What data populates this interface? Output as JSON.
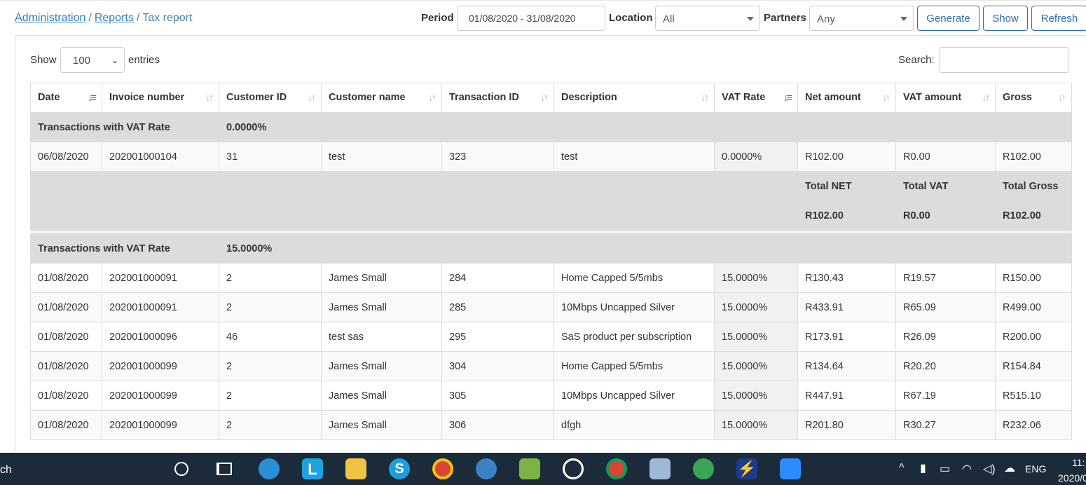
{
  "breadcrumb": {
    "items": [
      "Administration",
      "Reports",
      "Tax report"
    ]
  },
  "filters": {
    "period_label": "Period",
    "period_value": "01/08/2020 - 31/08/2020",
    "location_label": "Location",
    "location_value": "All",
    "partners_label": "Partners",
    "partners_value": "Any"
  },
  "buttons": {
    "generate": "Generate",
    "show": "Show",
    "refresh": "Refresh"
  },
  "table_controls": {
    "show_label": "Show",
    "entries_value": "100",
    "entries_label": "entries",
    "search_label": "Search:"
  },
  "columns": [
    "Date",
    "Invoice number",
    "Customer ID",
    "Customer name",
    "Transaction ID",
    "Description",
    "VAT Rate",
    "Net amount",
    "VAT amount",
    "Gross"
  ],
  "groups": [
    {
      "label": "Transactions with VAT Rate",
      "rate": "0.0000%",
      "rows": [
        [
          "06/08/2020",
          "202001000104",
          "31",
          "test",
          "323",
          "test",
          "0.0000%",
          "R102.00",
          "R0.00",
          "R102.00"
        ]
      ],
      "totals": {
        "net_label": "Total NET",
        "vat_label": "Total VAT",
        "gross_label": "Total Gross",
        "net": "R102.00",
        "vat": "R0.00",
        "gross": "R102.00"
      }
    },
    {
      "label": "Transactions with VAT Rate",
      "rate": "15.0000%",
      "rows": [
        [
          "01/08/2020",
          "202001000091",
          "2",
          "James Small",
          "284",
          "Home Capped 5/5mbs",
          "15.0000%",
          "R130.43",
          "R19.57",
          "R150.00"
        ],
        [
          "01/08/2020",
          "202001000091",
          "2",
          "James Small",
          "285",
          "10Mbps Uncapped Silver",
          "15.0000%",
          "R433.91",
          "R65.09",
          "R499.00"
        ],
        [
          "01/08/2020",
          "202001000096",
          "46",
          "test sas",
          "295",
          "SaS product per subscription",
          "15.0000%",
          "R173.91",
          "R26.09",
          "R200.00"
        ],
        [
          "01/08/2020",
          "202001000099",
          "2",
          "James Small",
          "304",
          "Home Capped 5/5mbs",
          "15.0000%",
          "R134.64",
          "R20.20",
          "R154.84"
        ],
        [
          "01/08/2020",
          "202001000099",
          "2",
          "James Small",
          "305",
          "10Mbps Uncapped Silver",
          "15.0000%",
          "R447.91",
          "R67.19",
          "R515.10"
        ],
        [
          "01/08/2020",
          "202001000099",
          "2",
          "James Small",
          "306",
          "dfgh",
          "15.0000%",
          "R201.80",
          "R30.27",
          "R232.06"
        ]
      ]
    }
  ],
  "taskbar": {
    "search_fragment": "ch",
    "language": "ENG",
    "time": "11:",
    "date": "2020/0"
  }
}
